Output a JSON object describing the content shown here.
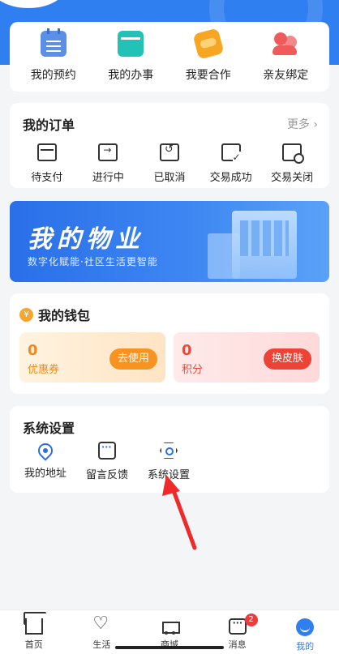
{
  "quick_actions": [
    {
      "label": "我的预约",
      "icon": "calendar-icon"
    },
    {
      "label": "我的办事",
      "icon": "briefcase-icon"
    },
    {
      "label": "我要合作",
      "icon": "handshake-icon"
    },
    {
      "label": "亲友绑定",
      "icon": "users-icon"
    }
  ],
  "orders": {
    "title": "我的订单",
    "more": "更多",
    "items": [
      {
        "label": "待支付",
        "icon": "wallet-card-icon"
      },
      {
        "label": "进行中",
        "icon": "in-progress-icon"
      },
      {
        "label": "已取消",
        "icon": "undo-icon"
      },
      {
        "label": "交易成功",
        "icon": "check-card-icon"
      },
      {
        "label": "交易关闭",
        "icon": "closed-card-icon"
      }
    ]
  },
  "banner": {
    "title": "我的物业",
    "subtitle": "数字化赋能·社区生活更智能"
  },
  "wallet": {
    "title": "我的钱包",
    "coupon": {
      "value": "0",
      "label": "优惠券",
      "button": "去使用"
    },
    "points": {
      "value": "0",
      "label": "积分",
      "button": "换皮肤"
    }
  },
  "settings": {
    "title": "系统设置",
    "items": [
      {
        "label": "我的地址",
        "icon": "location-icon"
      },
      {
        "label": "留言反馈",
        "icon": "feedback-icon"
      },
      {
        "label": "系统设置",
        "icon": "settings-icon"
      }
    ]
  },
  "tabbar": {
    "items": [
      {
        "label": "首页",
        "icon": "home-icon"
      },
      {
        "label": "生活",
        "icon": "heart-hand-icon"
      },
      {
        "label": "商城",
        "icon": "cart-icon"
      },
      {
        "label": "消息",
        "icon": "message-icon",
        "badge": "2"
      },
      {
        "label": "我的",
        "icon": "profile-icon",
        "active": true
      }
    ]
  },
  "colors": {
    "primary": "#2f7ff0",
    "coupon": "#f7931e",
    "points": "#ec4336"
  }
}
